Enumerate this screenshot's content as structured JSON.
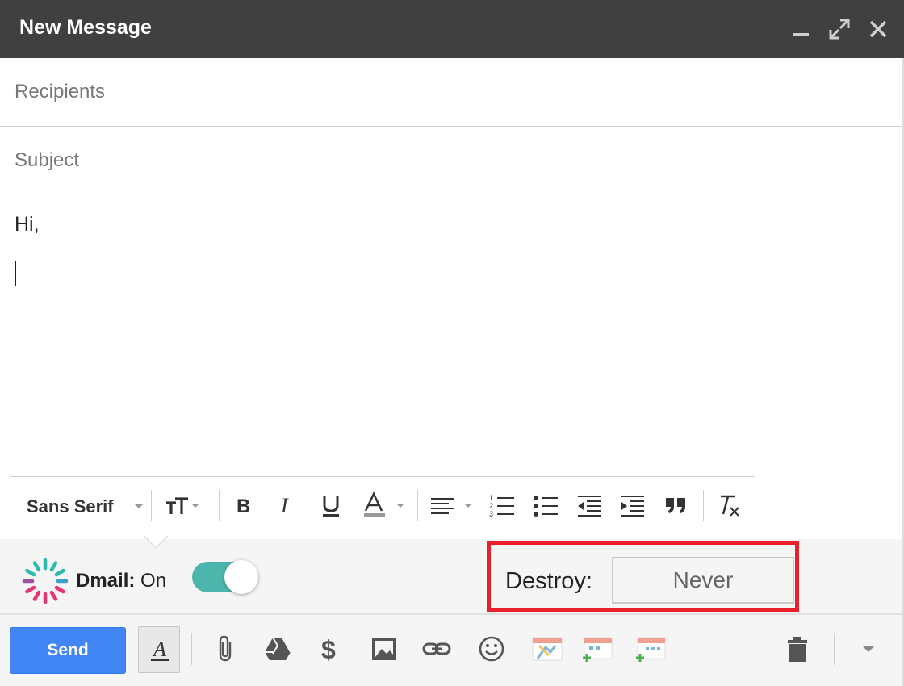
{
  "window": {
    "title": "New Message"
  },
  "fields": {
    "recipients_placeholder": "Recipients",
    "subject_placeholder": "Subject"
  },
  "message": {
    "greeting": "Hi,"
  },
  "formatting": {
    "font_family": "Sans Serif"
  },
  "dmail": {
    "brand": "Dmail:",
    "state": "On",
    "enabled": true,
    "destroy_label": "Destroy:",
    "destroy_value": "Never"
  },
  "actions": {
    "send_label": "Send"
  },
  "colors": {
    "titlebar": "#404040",
    "send": "#4285f4",
    "toggle": "#4db6ac",
    "highlight": "#e8202a"
  }
}
